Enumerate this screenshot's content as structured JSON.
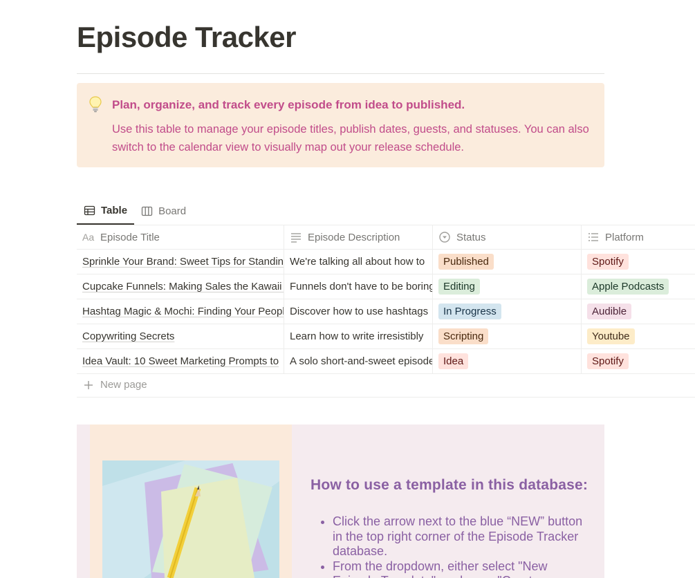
{
  "page": {
    "title": "Episode Tracker"
  },
  "callout": {
    "icon": "lightbulb-icon",
    "heading": "Plan, organize, and track every episode from idea to published.",
    "body": "Use this table to manage your episode titles, publish dates, guests, and statuses. You can also switch to the calendar view to visually map out your release schedule."
  },
  "views": [
    {
      "label": "Table",
      "icon": "table-icon",
      "active": true
    },
    {
      "label": "Board",
      "icon": "board-icon",
      "active": false
    }
  ],
  "table": {
    "columns": [
      {
        "label": "Episode Title",
        "icon": "Aa"
      },
      {
        "label": "Episode Description",
        "icon": "text-lines-icon"
      },
      {
        "label": "Status",
        "icon": "status-icon"
      },
      {
        "label": "Platform",
        "icon": "list-icon"
      }
    ],
    "rows": [
      {
        "title": "Sprinkle Your Brand: Sweet Tips for Standing Out",
        "description": "We're talking all about how to",
        "status": "Published",
        "platform": "Spotify"
      },
      {
        "title": "Cupcake Funnels: Making Sales the Kawaii Way",
        "description": "Funnels don't have to be boring",
        "status": "Editing",
        "platform": "Apple Podcasts"
      },
      {
        "title": "Hashtag Magic & Mochi: Finding Your People",
        "description": "Discover how to use hashtags",
        "status": "In Progress",
        "platform": "Audible"
      },
      {
        "title": "Copywriting Secrets",
        "description": "Learn how to write irresistibly",
        "status": "Scripting",
        "platform": "Youtube"
      },
      {
        "title": "Idea Vault: 10 Sweet Marketing Prompts to",
        "description": "A solo short-and-sweet episode",
        "status": "Idea",
        "platform": "Spotify"
      }
    ],
    "new_page_label": "New page"
  },
  "tag_colors": {
    "Published": {
      "bg": "#fadec9",
      "fg": "#49290e"
    },
    "Editing": {
      "bg": "#dbeddb",
      "fg": "#1c3829"
    },
    "In Progress": {
      "bg": "#d3e5ef",
      "fg": "#183347"
    },
    "Scripting": {
      "bg": "#fadec9",
      "fg": "#49290e"
    },
    "Idea": {
      "bg": "#ffe2dd",
      "fg": "#5d1715"
    },
    "Spotify": {
      "bg": "#ffe2dd",
      "fg": "#5d1715"
    },
    "Apple Podcasts": {
      "bg": "#dbeddb",
      "fg": "#1c3829"
    },
    "Audible": {
      "bg": "#f5e0e9",
      "fg": "#4c2337"
    },
    "Youtube": {
      "bg": "#fdecc8",
      "fg": "#402c1b"
    }
  },
  "howto": {
    "title": "How to use a template in this database:",
    "items": [
      "Click the arrow next to the blue “NEW” button in the top right corner of the Episode Tracker database.",
      "From the dropdown, either select \"New Episode Template\" or choose \"Create"
    ]
  }
}
